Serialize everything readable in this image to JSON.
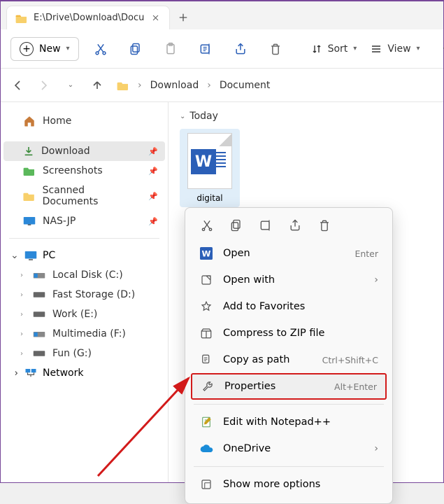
{
  "tab": {
    "title": "E:\\Drive\\Download\\Docu"
  },
  "toolbar": {
    "new_label": "New",
    "sort_label": "Sort",
    "view_label": "View"
  },
  "breadcrumb": {
    "parts": [
      "Download",
      "Document"
    ]
  },
  "sidebar": {
    "home_label": "Home",
    "quick": [
      {
        "label": "Download",
        "icon": "download",
        "selected": true,
        "pinned": true
      },
      {
        "label": "Screenshots",
        "icon": "folder-green",
        "selected": false,
        "pinned": true
      },
      {
        "label": "Scanned Documents",
        "icon": "folder",
        "selected": false,
        "pinned": true
      },
      {
        "label": "NAS-JP",
        "icon": "monitor",
        "selected": false,
        "pinned": true
      }
    ],
    "pc_label": "PC",
    "drives": [
      {
        "label": "Local Disk (C:)",
        "icon": "drive-win"
      },
      {
        "label": "Fast Storage (D:)",
        "icon": "drive"
      },
      {
        "label": "Work (E:)",
        "icon": "drive"
      },
      {
        "label": "Multimedia (F:)",
        "icon": "drive-win"
      },
      {
        "label": "Fun (G:)",
        "icon": "drive"
      }
    ],
    "network_label": "Network"
  },
  "content": {
    "group_label": "Today",
    "file_label": "digital"
  },
  "ctxmenu": {
    "items": [
      {
        "key": "open",
        "label": "Open",
        "shortcut": "Enter",
        "icon": "word"
      },
      {
        "key": "openwith",
        "label": "Open with",
        "submenu": true,
        "icon": "openwith"
      },
      {
        "key": "fav",
        "label": "Add to Favorites",
        "icon": "star"
      },
      {
        "key": "zip",
        "label": "Compress to ZIP file",
        "icon": "zip"
      },
      {
        "key": "copypath",
        "label": "Copy as path",
        "shortcut": "Ctrl+Shift+C",
        "icon": "copypath"
      },
      {
        "key": "props",
        "label": "Properties",
        "shortcut": "Alt+Enter",
        "icon": "wrench",
        "highlight": true
      },
      {
        "key": "notepad",
        "label": "Edit with Notepad++",
        "icon": "notepad"
      },
      {
        "key": "onedrive",
        "label": "OneDrive",
        "submenu": true,
        "icon": "cloud"
      },
      {
        "key": "more",
        "label": "Show more options",
        "icon": "more"
      }
    ]
  }
}
